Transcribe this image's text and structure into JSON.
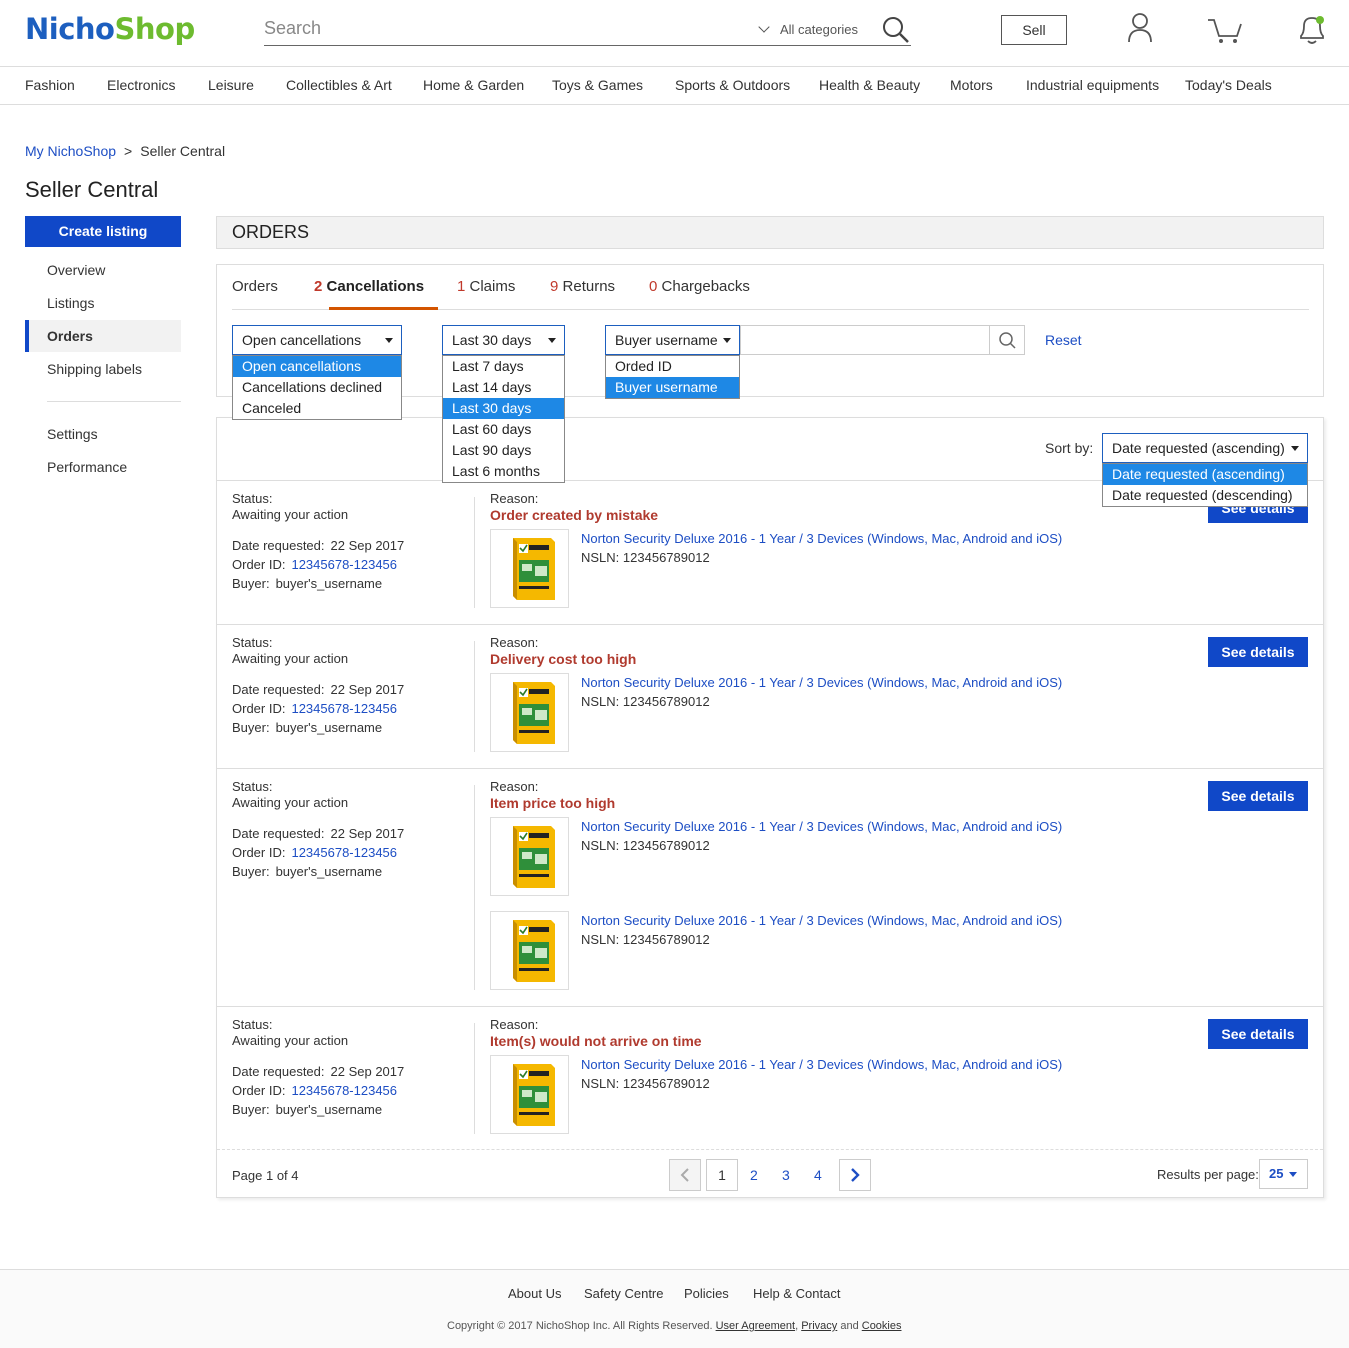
{
  "header": {
    "logo_part1": "Nicho",
    "logo_part2": "Shop",
    "search_placeholder": "Search",
    "all_categories": "All categories",
    "sell": "Sell"
  },
  "categories": [
    "Fashion",
    "Electronics",
    "Leisure",
    "Collectibles & Art",
    "Home & Garden",
    "Toys & Games",
    "Sports & Outdoors",
    "Health & Beauty",
    "Motors",
    "Industrial equipments",
    "Today's Deals"
  ],
  "breadcrumb": {
    "home": "My NichoShop",
    "sep": ">",
    "current": "Seller Central"
  },
  "page_title": "Seller Central",
  "sidebar": {
    "create": "Create listing",
    "items": [
      "Overview",
      "Listings",
      "Orders",
      "Shipping labels"
    ],
    "items2": [
      "Settings",
      "Performance"
    ],
    "active": "Orders"
  },
  "section_title": "ORDERS",
  "tabs": [
    {
      "count": "",
      "label": "Orders"
    },
    {
      "count": "2",
      "label": "Cancellations"
    },
    {
      "count": "1",
      "label": "Claims"
    },
    {
      "count": "9",
      "label": "Returns"
    },
    {
      "count": "0",
      "label": "Chargebacks"
    }
  ],
  "filters": {
    "type": {
      "value": "Open cancellations",
      "options": [
        "Open cancellations",
        "Cancellations declined",
        "Canceled"
      ]
    },
    "period": {
      "value": "Last 30 days",
      "options": [
        "Last 7 days",
        "Last 14 days",
        "Last 30 days",
        "Last 60 days",
        "Last 90 days",
        "Last 6 months"
      ]
    },
    "search_by": {
      "value": "Buyer username",
      "options": [
        "Orded ID",
        "Buyer username"
      ]
    },
    "reset": "Reset"
  },
  "sort": {
    "label": "Sort by:",
    "value": "Date requested (ascending)",
    "options": [
      "Date requested (ascending)",
      "Date requested (descending)"
    ]
  },
  "labels": {
    "status": "Status:",
    "date_requested": "Date requested:",
    "order_id": "Order ID:",
    "buyer": "Buyer:",
    "reason": "Reason:",
    "nsln": "NSLN:",
    "see_details": "See details"
  },
  "rows": [
    {
      "status": "Awaiting your action",
      "date": "22 Sep 2017",
      "order_id": "12345678-123456",
      "buyer": "buyer's_username",
      "reason": "Order created by mistake",
      "items": [
        {
          "title": "Norton Security Deluxe 2016 - 1 Year / 3 Devices (Windows, Mac, Android and iOS)",
          "nsln": "123456789012"
        }
      ]
    },
    {
      "status": "Awaiting your action",
      "date": "22 Sep 2017",
      "order_id": "12345678-123456",
      "buyer": "buyer's_username",
      "reason": "Delivery cost too high",
      "items": [
        {
          "title": "Norton Security Deluxe 2016 - 1 Year / 3 Devices (Windows, Mac, Android and iOS)",
          "nsln": "123456789012"
        }
      ]
    },
    {
      "status": "Awaiting your action",
      "date": "22 Sep 2017",
      "order_id": "12345678-123456",
      "buyer": "buyer's_username",
      "reason": "Item price too high",
      "items": [
        {
          "title": "Norton Security Deluxe 2016 - 1 Year / 3 Devices (Windows, Mac, Android and iOS)",
          "nsln": "123456789012"
        },
        {
          "title": "Norton Security Deluxe 2016 - 1 Year / 3 Devices (Windows, Mac, Android and iOS)",
          "nsln": "123456789012"
        }
      ]
    },
    {
      "status": "Awaiting your action",
      "date": "22 Sep 2017",
      "order_id": "12345678-123456",
      "buyer": "buyer's_username",
      "reason": "Item(s) would not arrive on time",
      "items": [
        {
          "title": "Norton Security Deluxe 2016 - 1 Year / 3 Devices (Windows, Mac, Android and iOS)",
          "nsln": "123456789012"
        }
      ]
    }
  ],
  "pagination": {
    "page_of": "Page 1 of 4",
    "pages": [
      "1",
      "2",
      "3",
      "4"
    ],
    "current": "1",
    "results_label": "Results per page:",
    "results_value": "25"
  },
  "footer": {
    "links": [
      "About Us",
      "Safety Centre",
      "Policies",
      "Help & Contact"
    ],
    "copyright": "Copyright © 2017 NichoShop Inc. All Rights Reserved.",
    "user_agreement": "User Agreement",
    "comma": ",",
    "privacy": "Privacy",
    "and": "and",
    "cookies": "Cookies"
  },
  "colors": {
    "brand_blue": "#1d5fbf",
    "brand_green": "#6dbb2f",
    "primary_button": "#1048c8",
    "reason_red": "#b03a2e",
    "tab_accent": "#d35400",
    "selected_option": "#1e88e5"
  }
}
